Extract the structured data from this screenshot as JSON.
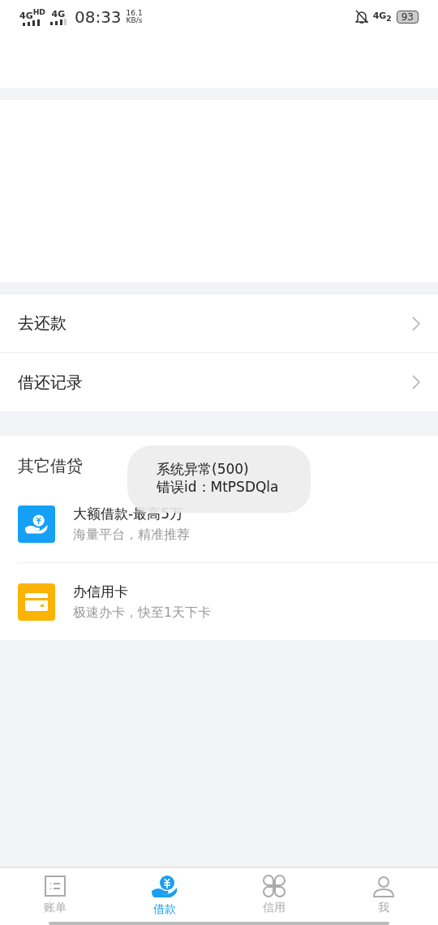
{
  "status_bar": {
    "network_1": "4G",
    "network_1_badge": "HD",
    "network_2": "4G",
    "time": "08:33",
    "speed": "16.1",
    "speed_unit": "KB/s",
    "network_3": "4G",
    "network_3_sub": "2",
    "battery": "93"
  },
  "menu": [
    {
      "label": "去还款"
    },
    {
      "label": "借还记录"
    }
  ],
  "other_loans": {
    "title": "其它借贷",
    "items": [
      {
        "kind": "loan",
        "title": "大额借款-最高5万",
        "subtitle": "海量平台，精准推荐"
      },
      {
        "kind": "card",
        "title": "办信用卡",
        "subtitle": "极速办卡，快至1天下卡"
      }
    ]
  },
  "toast": {
    "lines": [
      "系统异常(500)",
      "错误id：MtPSDQla"
    ]
  },
  "tab_bar": [
    {
      "label": "账单",
      "kind": "bill",
      "selected": false
    },
    {
      "label": "借款",
      "kind": "loan",
      "selected": true
    },
    {
      "label": "信用",
      "kind": "credit",
      "selected": false
    },
    {
      "label": "我",
      "kind": "me",
      "selected": false
    }
  ]
}
